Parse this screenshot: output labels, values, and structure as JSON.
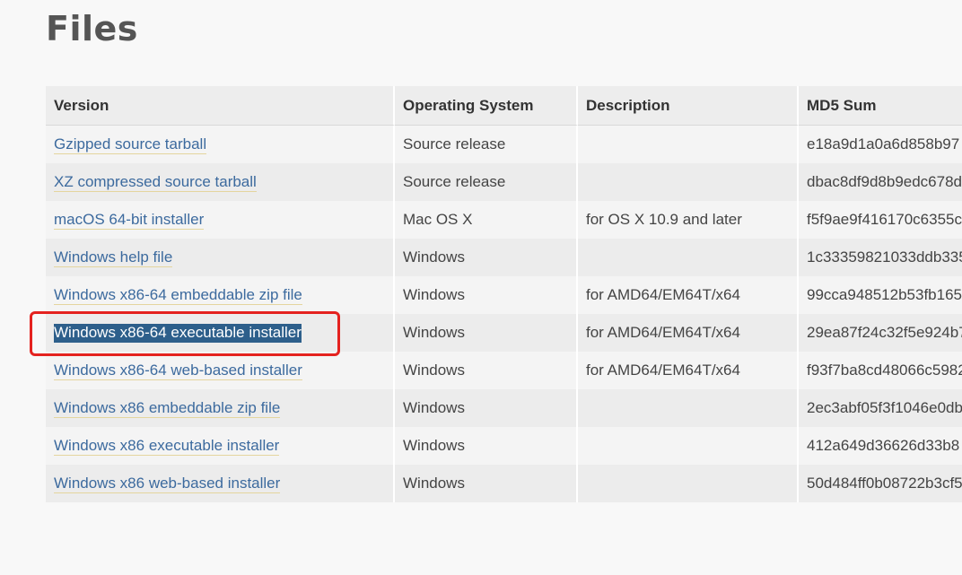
{
  "page": {
    "title": "Files"
  },
  "table": {
    "headers": [
      "Version",
      "Operating System",
      "Description",
      "MD5 Sum"
    ],
    "rows": [
      {
        "version": "Gzipped source tarball",
        "os": "Source release",
        "description": "",
        "md5": "e18a9d1a0a6d858b97"
      },
      {
        "version": "XZ compressed source tarball",
        "os": "Source release",
        "description": "",
        "md5": "dbac8df9d8b9edc678d"
      },
      {
        "version": "macOS 64-bit installer",
        "os": "Mac OS X",
        "description": "for OS X 10.9 and later",
        "md5": "f5f9ae9f416170c6355c"
      },
      {
        "version": "Windows help file",
        "os": "Windows",
        "description": "",
        "md5": "1c33359821033ddb335"
      },
      {
        "version": "Windows x86-64 embeddable zip file",
        "os": "Windows",
        "description": "for AMD64/EM64T/x64",
        "md5": "99cca948512b53fb165"
      },
      {
        "version": "Windows x86-64 executable installer",
        "os": "Windows",
        "description": "for AMD64/EM64T/x64",
        "md5": "29ea87f24c32f5e924b7"
      },
      {
        "version": "Windows x86-64 web-based installer",
        "os": "Windows",
        "description": "for AMD64/EM64T/x64",
        "md5": "f93f7ba8cd48066c5982"
      },
      {
        "version": "Windows x86 embeddable zip file",
        "os": "Windows",
        "description": "",
        "md5": "2ec3abf05f3f1046e0db"
      },
      {
        "version": "Windows x86 executable installer",
        "os": "Windows",
        "description": "",
        "md5": "412a649d36626d33b8"
      },
      {
        "version": "Windows x86 web-based installer",
        "os": "Windows",
        "description": "",
        "md5": "50d484ff0b08722b3cf5"
      }
    ],
    "selected_row": 5
  },
  "colors": {
    "link": "#3c6a9e",
    "selection": "#2d5f8b",
    "highlight_box": "#e4221f",
    "link_underline": "#e4d59e"
  }
}
